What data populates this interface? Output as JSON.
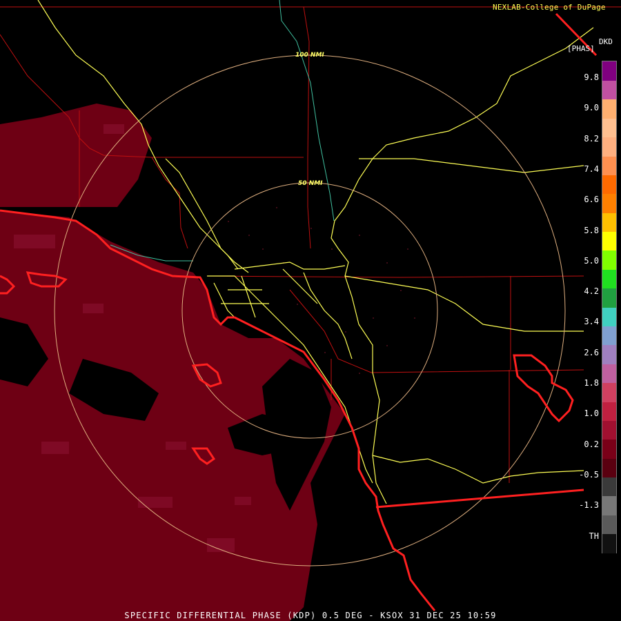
{
  "credit": "NEXLAB-College of DuPage",
  "product_code": "DKD",
  "units": "[PHAS]",
  "footer": "SPECIFIC DIFFERENTIAL PHASE (KDP) 0.5 DEG - KSOX 31 DEC 25 10:59",
  "range_rings": [
    {
      "label": "100 NMI",
      "nmi": 100
    },
    {
      "label": "50 NMI",
      "nmi": 50
    }
  ],
  "legend": {
    "ticks": [
      "9.8",
      "9.0",
      "8.2",
      "7.4",
      "6.6",
      "5.8",
      "5.0",
      "4.2",
      "3.4",
      "2.6",
      "1.8",
      "1.0",
      "0.2",
      "-0.5",
      "-1.3",
      "TH"
    ],
    "colors": [
      "#111111",
      "#5a5a5a",
      "#777777",
      "#3a3a3a",
      "#5a0010",
      "#7a0018",
      "#a01030",
      "#c02040",
      "#d04060",
      "#c060a0",
      "#a080c0",
      "#80a0d0",
      "#40d0c0",
      "#20a040",
      "#20e020",
      "#80ff00",
      "#ffff00",
      "#ffc000",
      "#ff8000",
      "#ff6a00",
      "#ff9050",
      "#ffb080",
      "#ffc090",
      "#ffb070",
      "#c050a0",
      "#800080"
    ]
  },
  "colors": {
    "echo": "#6e0014",
    "echo_light": "#8a1030",
    "coast": "#ff2020",
    "roads": "#ffff55",
    "county": "#c01010",
    "rings": "#e0b080",
    "river": "#40c0a0"
  }
}
